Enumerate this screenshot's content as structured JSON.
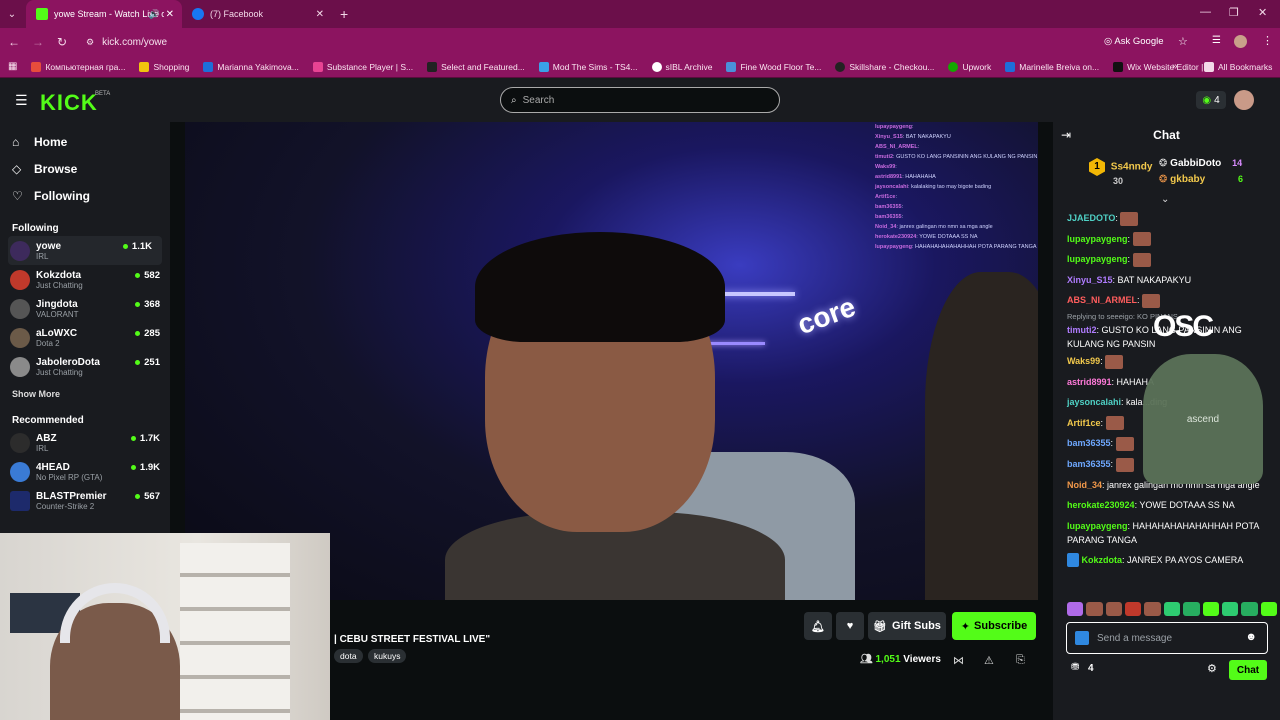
{
  "browser": {
    "tabs": [
      {
        "label": "yowe Stream - Watch Live o",
        "active": true
      },
      {
        "label": "(7) Facebook",
        "active": false
      }
    ],
    "url": "kick.com/yowe",
    "ask_google": "Ask Google",
    "bookmarks": [
      "Компьютерная гра...",
      "Shopping",
      "Marianna Yakimova...",
      "Substance Player | S...",
      "Select and Featured...",
      "Mod The Sims - TS4...",
      "sIBL Archive",
      "Fine Wood Floor Te...",
      "Skillshare - Checkou...",
      "Upwork",
      "Marinelle Breiva on...",
      "Wix Website Editor |..."
    ],
    "all_bookmarks": "All Bookmarks"
  },
  "header": {
    "logo": "KICK",
    "beta": "BETA",
    "search_placeholder": "Search",
    "coins": "4"
  },
  "sidebar": {
    "nav": [
      {
        "label": "Home",
        "icon": "home-icon"
      },
      {
        "label": "Browse",
        "icon": "browse-icon"
      },
      {
        "label": "Following",
        "icon": "heart-icon"
      }
    ],
    "following_title": "Following",
    "following": [
      {
        "name": "yowe",
        "category": "IRL",
        "viewers": "1.1K"
      },
      {
        "name": "Kokzdota",
        "category": "Just Chatting",
        "viewers": "582"
      },
      {
        "name": "Jingdota",
        "category": "VALORANT",
        "viewers": "368"
      },
      {
        "name": "aLoWXC",
        "category": "Dota 2",
        "viewers": "285"
      },
      {
        "name": "JaboleroDota",
        "category": "Just Chatting",
        "viewers": "251"
      }
    ],
    "show_more": "Show More",
    "recommended_title": "Recommended",
    "recommended": [
      {
        "name": "ABZ",
        "category": "IRL",
        "viewers": "1.7K"
      },
      {
        "name": "4HEAD",
        "category": "No Pixel RP (GTA)",
        "viewers": "1.9K"
      },
      {
        "name": "BLASTPremier",
        "category": "Counter-Strike 2",
        "viewers": "567"
      }
    ]
  },
  "video": {
    "sign": "core",
    "overlay_chat": [
      {
        "user": "lupaypaygeng",
        "text": ":"
      },
      {
        "user": "Xinyu_S15",
        "text": ": BAT NAKAPAKYU"
      },
      {
        "user": "ABS_NI_ARMEL",
        "text": ":"
      },
      {
        "user": "timuti2",
        "text": ": GUSTO KO LANG PANSININ ANG KULANG NG PANSIN"
      },
      {
        "user": "Waks99",
        "text": ":"
      },
      {
        "user": "astrid8991",
        "text": ": HAHAHAHA"
      },
      {
        "user": "jaysoncalahi",
        "text": ": kalalaking tao may bigote bading"
      },
      {
        "user": "Artif1ce",
        "text": ":"
      },
      {
        "user": "bam36355",
        "text": ":"
      },
      {
        "user": "bam36355",
        "text": ":"
      },
      {
        "user": "Noid_34",
        "text": ": janrex galingan mo nmn sa mga angle"
      },
      {
        "user": "herokate230924",
        "text": ": YOWE DOTAAA SS NA"
      },
      {
        "user": "lupaypaygeng",
        "text": ": HAHAHAHAHAHAHHAH POTA PARANG TANGA"
      }
    ]
  },
  "stream": {
    "title": "| CEBU STREET FESTIVAL LIVE\"",
    "tags": [
      "dota",
      "kukuys"
    ],
    "gift_subs": "Gift Subs",
    "subscribe": "Subscribe",
    "viewers_count": "1,051",
    "viewers_label": "Viewers"
  },
  "chat": {
    "title": "Chat",
    "leaders": [
      {
        "rank": "1",
        "name": "Ss4nndy",
        "count": "30"
      },
      {
        "name": "GabbiDoto",
        "count": "14"
      },
      {
        "name": "gkbaby",
        "count": "6"
      }
    ],
    "reply_text": "Replying to seeeigo: KO PINANS...",
    "messages": [
      {
        "user": "JJAEDOTO",
        "color": "#4fd1c5",
        "text": "",
        "emote": true
      },
      {
        "user": "lupaypaygeng",
        "color": "#53fc18",
        "text": "",
        "emote": true
      },
      {
        "user": "lupaypaygeng",
        "color": "#53fc18",
        "text": "",
        "emote": true
      },
      {
        "user": "Xinyu_S15",
        "color": "#b07cff",
        "text": "BAT NAKAPAKYU",
        "emote": false
      },
      {
        "user": "ABS_NI_ARMEL",
        "color": "#ff5d5d",
        "text": "",
        "emote": true
      },
      {
        "user": "timuti2",
        "color": "#b07cff",
        "text": "GUSTO KO LANG PANSININ ANG KULANG NG PANSIN",
        "emote": false
      },
      {
        "user": "Waks99",
        "color": "#f2c94c",
        "text": "",
        "emote": true
      },
      {
        "user": "astrid8991",
        "color": "#ff7ad9",
        "text": "HAHAHA",
        "emote": false
      },
      {
        "user": "jaysoncalahi",
        "color": "#4fd1c5",
        "text": "kala...ding",
        "emote": false
      },
      {
        "user": "Artif1ce",
        "color": "#f2c94c",
        "text": "",
        "emote": true
      },
      {
        "user": "bam36355",
        "color": "#6ea8ff",
        "text": "",
        "emote": true
      },
      {
        "user": "bam36355",
        "color": "#6ea8ff",
        "text": "",
        "emote": true
      },
      {
        "user": "Noid_34",
        "color": "#f2994a",
        "text": "janrex galingan mo nmn sa mga angle",
        "emote": false
      },
      {
        "user": "herokate230924",
        "color": "#53fc18",
        "text": "YOWE DOTAAA SS NA",
        "emote": false
      },
      {
        "user": "lupaypaygeng",
        "color": "#53fc18",
        "text": "HAHAHAHAHAHAHHAH POTA PARANG TANGA",
        "emote": false
      },
      {
        "user": "Kokzdota",
        "color": "#53fc18",
        "text": "JANREX PA AYOS CAMERA",
        "emote": false
      }
    ],
    "overlay_logo": "OSC",
    "overlay_brand": "ascend",
    "input_placeholder": "Send a message",
    "points": "4",
    "send": "Chat"
  }
}
